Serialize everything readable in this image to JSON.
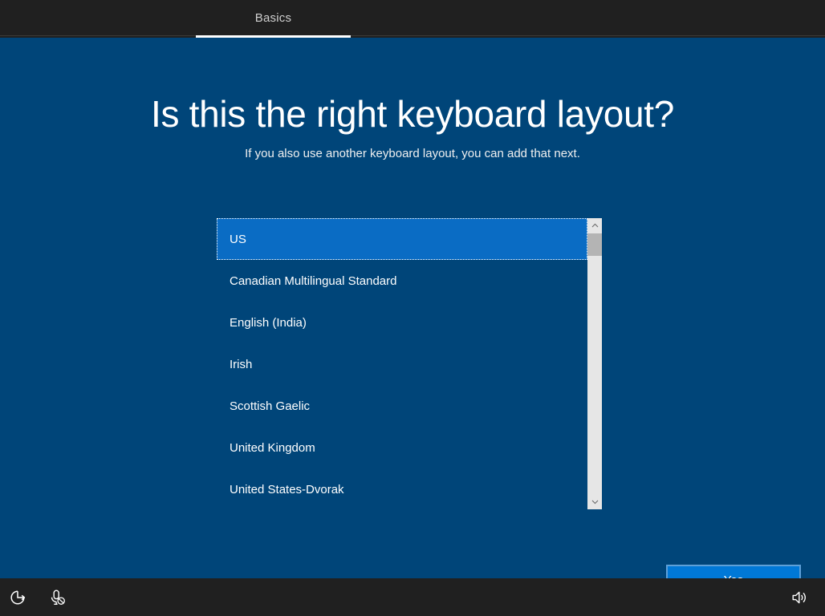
{
  "header": {
    "tab_label": "Basics",
    "tab_name": "basics"
  },
  "main": {
    "title": "Is this the right keyboard layout?",
    "subtitle": "If you also use another keyboard layout, you can add that next."
  },
  "keyboard_list": {
    "selected_index": 0,
    "items": [
      {
        "label": "US",
        "selected": true
      },
      {
        "label": "Canadian Multilingual Standard",
        "selected": false
      },
      {
        "label": "English (India)",
        "selected": false
      },
      {
        "label": "Irish",
        "selected": false
      },
      {
        "label": "Scottish Gaelic",
        "selected": false
      },
      {
        "label": "United Kingdom",
        "selected": false
      },
      {
        "label": "United States-Dvorak",
        "selected": false
      }
    ],
    "scrollbar": {
      "up_arrow_icon": "chevron-up-icon",
      "down_arrow_icon": "chevron-down-icon",
      "thumb_position_percent": 5
    }
  },
  "footer": {
    "yes_label": "Yes"
  },
  "taskbar": {
    "icons": [
      {
        "name": "ease-of-access-icon",
        "label": "Ease of access"
      },
      {
        "name": "microphone-icon",
        "label": "Microphone off"
      },
      {
        "name": "volume-icon",
        "label": "Volume"
      }
    ]
  },
  "colors": {
    "background": "#004579",
    "chrome": "#202020",
    "accent": "#0078d7",
    "selection": "#0a6cc4",
    "scroll_track": "#e6e6e6",
    "scroll_thumb": "#b4b4b4"
  }
}
